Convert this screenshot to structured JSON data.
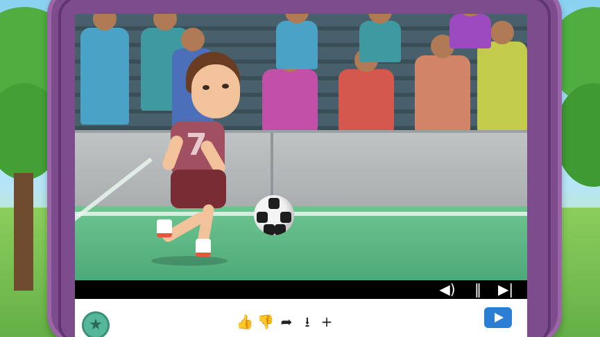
{
  "player": {
    "jersey_number": "7"
  },
  "controls": {
    "volume_icon": "speaker-icon",
    "pause_icon": "pause-icon",
    "next_icon": "skip-next-icon"
  },
  "toolbar": {
    "avatar_icon": "star-icon",
    "actions": [
      {
        "name": "like-button",
        "icon": "thumbs-up-icon",
        "glyph": "👍"
      },
      {
        "name": "dislike-button",
        "icon": "thumbs-down-icon",
        "glyph": "👎"
      },
      {
        "name": "share-button",
        "icon": "share-arrow-icon",
        "glyph": "➦"
      },
      {
        "name": "download-button",
        "icon": "download-icon",
        "glyph": "⭳"
      },
      {
        "name": "add-button",
        "icon": "plus-icon",
        "glyph": "+"
      }
    ],
    "play_button_icon": "play-icon"
  },
  "colors": {
    "frame": "#7d4c8c",
    "accent_blue": "#2a7fd4",
    "controls_bg": "#000000"
  }
}
